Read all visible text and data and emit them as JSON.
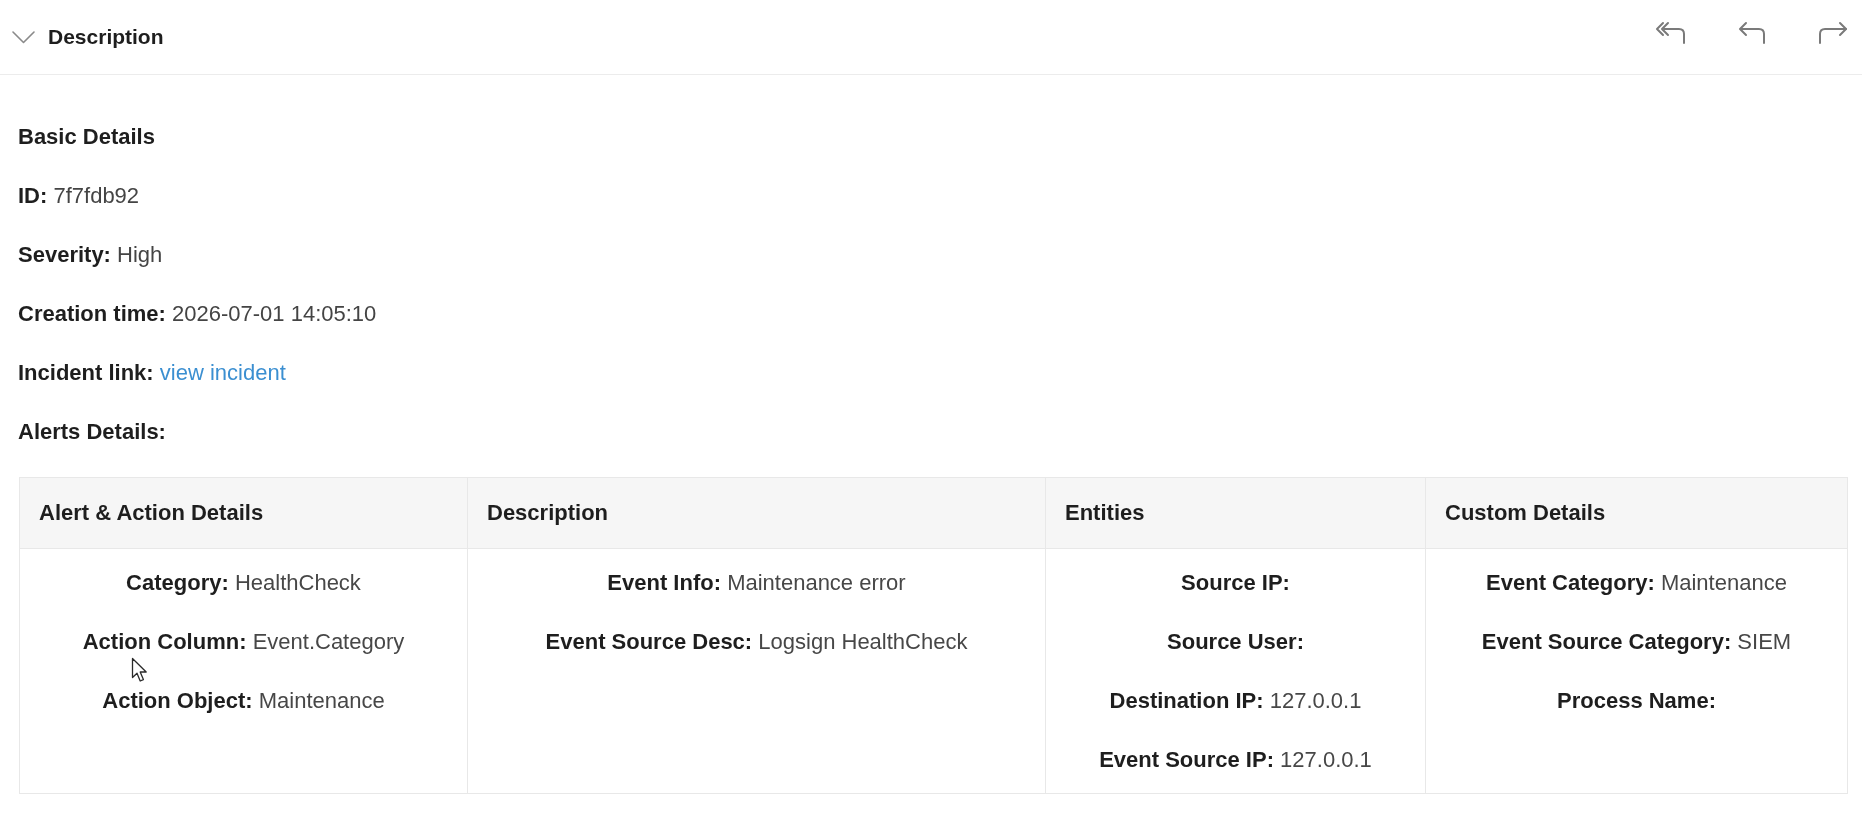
{
  "panel": {
    "title": "Description",
    "expanded": true,
    "actions": [
      {
        "kind": "reply_all"
      },
      {
        "kind": "reply"
      },
      {
        "kind": "forward"
      }
    ]
  },
  "basic_details": {
    "title": "Basic Details",
    "fields": [
      {
        "label": "ID:",
        "value": "7f7fdb92",
        "kind": "text"
      },
      {
        "label": "Severity:",
        "value": "High",
        "kind": "text"
      },
      {
        "label": "Creation time:",
        "value": "2026-07-01 14:05:10",
        "kind": "text"
      },
      {
        "label": "Incident link:",
        "value": "view incident",
        "kind": "link"
      }
    ]
  },
  "alerts_details": {
    "title": "Alerts Details:",
    "table": {
      "columns": [
        "Alert & Action Details",
        "Description",
        "Entities",
        "Custom Details"
      ],
      "rows": [
        {
          "cells": [
            [
              {
                "label": "Category:",
                "value": "HealthCheck"
              },
              {
                "label": "Action Column:",
                "value": "Event.Category"
              },
              {
                "label": "Action Object:",
                "value": "Maintenance"
              }
            ],
            [
              {
                "label": "Event Info:",
                "value": "Maintenance error"
              },
              {
                "label": "Event Source Desc:",
                "value": "Logsign HealthCheck"
              }
            ],
            [
              {
                "label": "Source IP:"
              },
              {
                "label": "Source User:"
              },
              {
                "label": "Destination IP:",
                "value": "127.0.0.1"
              },
              {
                "label": "Event Source IP:",
                "value": "127.0.0.1"
              }
            ],
            [
              {
                "label": "Event Category:",
                "value": "Maintenance"
              },
              {
                "label": "Event Source Category:",
                "value": "SIEM"
              },
              {
                "label": "Process Name:"
              }
            ]
          ]
        }
      ]
    }
  }
}
